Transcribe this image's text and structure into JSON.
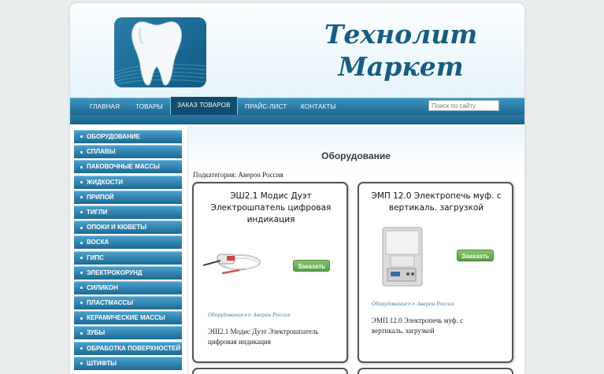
{
  "header": {
    "site_title_line1": "Технолит",
    "site_title_line2": "Маркет"
  },
  "nav": {
    "items": [
      "ГЛАВНАЯ",
      "ТОВАРЫ",
      "ЗАКАЗ ТОВАРОВ",
      "ПРАЙС-ЛИСТ",
      "КОНТАКТЫ"
    ],
    "active_item": "ЗАКАЗ ТОВАРОВ",
    "search_placeholder": "Поиск по сайту"
  },
  "sidebar": {
    "items": [
      "ОБОРУДОВАНИЕ",
      "СПЛАВЫ",
      "ПАКОВОЧНЫЕ МАССЫ",
      "ЖИДКОСТИ",
      "ПРИПОЙ",
      "ТИГЛИ",
      "ОПОКИ И КЮВЕТЫ",
      "ВОСКА",
      "ГИПС",
      "ЭЛЕКТРОКОРУНД",
      "СИЛИКОН",
      "ПЛАСТМАССЫ",
      "КЕРАМИЧЕСКИЕ МАССЫ",
      "ЗУБЫ",
      "ОБРАБОТКА ПОВЕРХНОСТЕЙ",
      "ШТИФТЫ"
    ]
  },
  "main": {
    "title": "Оборудование",
    "subcategory": "Подкатегория: Аверон Россия",
    "products": [
      {
        "title": "ЭШ2.1 Модис Дуэт Электрошпатель цифровая индикация",
        "button": "Заказать",
        "breadcrumb": "Оборудование>> Аверон Россия",
        "description": "ЭШ2.1 Модис Дуэт Электрошпатель цифровая индикация",
        "image_icon": "electric-spatula-icon"
      },
      {
        "title": "ЭМП 12.0 Электропечь муф. с вертикаль. загрузкой",
        "button": "Заказать",
        "breadcrumb": "Оборудование>> Аверон Россия",
        "description": "ЭМП 12.0 Электропечь муф. с вертикаль. загрузкой",
        "image_icon": "muffle-furnace-icon"
      }
    ]
  },
  "colors": {
    "accent": "#1c678f",
    "title": "#185c82",
    "button": "#6aae52"
  }
}
